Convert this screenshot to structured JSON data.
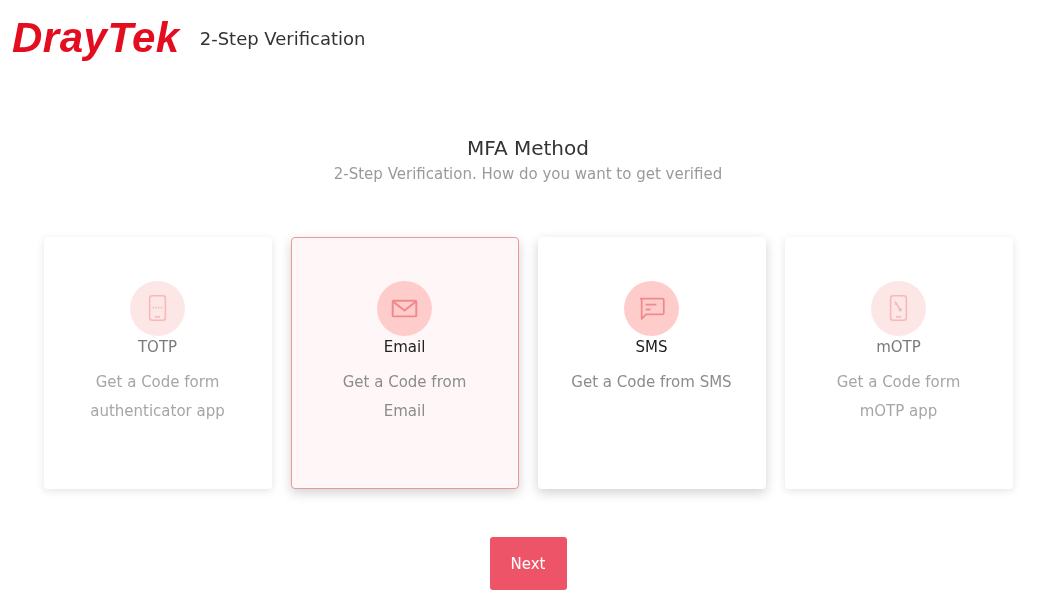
{
  "header": {
    "logo": "DrayTek",
    "title": "2-Step Verification"
  },
  "heading": {
    "title": "MFA Method",
    "subtitle": "2-Step Verification. How do you want to get verified"
  },
  "methods": [
    {
      "kind": "totp",
      "label": "TOTP",
      "description": "Get a Code form authenticator app",
      "selected": false,
      "disabled": true
    },
    {
      "kind": "email",
      "label": "Email",
      "description": "Get a Code from Email",
      "selected": true,
      "disabled": false
    },
    {
      "kind": "sms",
      "label": "SMS",
      "description": "Get a Code from SMS",
      "selected": false,
      "disabled": false
    },
    {
      "kind": "motp",
      "label": "mOTP",
      "description": "Get a Code form mOTP app",
      "selected": false,
      "disabled": true
    }
  ],
  "buttons": [
    {
      "label": "Next"
    }
  ]
}
